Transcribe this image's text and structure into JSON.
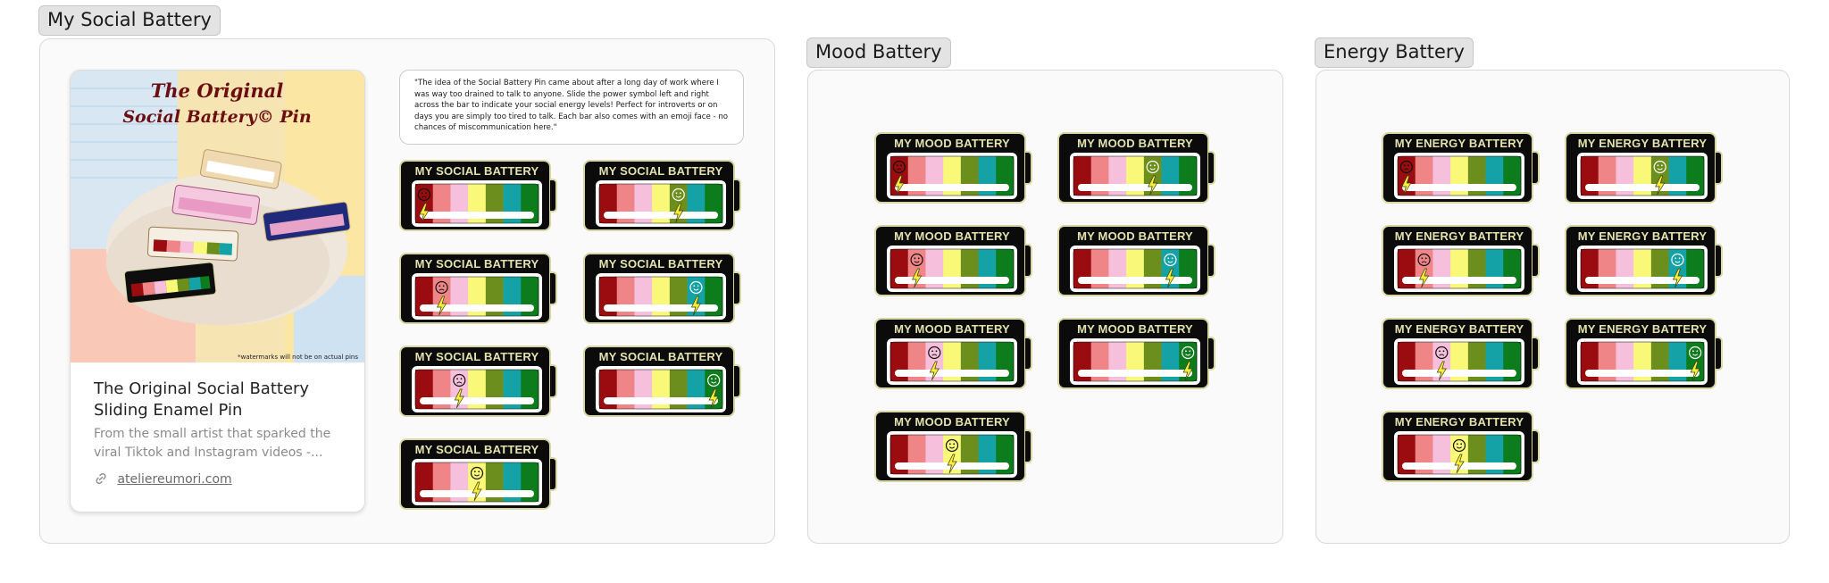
{
  "sections": {
    "social": {
      "label": "My Social Battery"
    },
    "mood": {
      "label": "Mood Battery"
    },
    "energy": {
      "label": "Energy Battery"
    }
  },
  "card": {
    "image_text_line1": "The Original",
    "image_text_line2": "Social Battery© Pin",
    "watermark_note": "*watermarks will not be on actual pins",
    "title": "The Original Social Battery Sliding Enamel Pin",
    "description": "From the small artist that sparked the viral Tiktok and Instagram videos -...",
    "link": "ateliereumori.com"
  },
  "quote": "\"The idea of the Social Battery Pin came about after a long day of work where I was way too drained to talk to anyone. Slide the power symbol left and right across the bar to indicate your social energy levels! Perfect for introverts or on days you are simply too tired to talk. Each bar also comes with an emoji face - no chances of miscommunication here.\"",
  "battery_titles": {
    "social": "MY SOCIAL BATTERY",
    "mood": "MY MOOD BATTERY",
    "energy": "MY ENERGY BATTERY"
  },
  "colors": {
    "segments": [
      "#9a0c0f",
      "#ef8587",
      "#f6c0dc",
      "#f9f879",
      "#6c8e1c",
      "#15a2a6",
      "#0d7c1c"
    ],
    "battery_border": "#d8d6a2",
    "title_text": "#e3e1ac"
  },
  "batteries": {
    "social": [
      {
        "level": 1,
        "face": "sad"
      },
      {
        "level": 5,
        "face": "happy"
      },
      {
        "level": 2,
        "face": "sad"
      },
      {
        "level": 6,
        "face": "happy"
      },
      {
        "level": 3,
        "face": "sad"
      },
      {
        "level": 7,
        "face": "happy"
      },
      {
        "level": 4,
        "face": "happy"
      }
    ],
    "mood": [
      {
        "level": 1,
        "face": "sad"
      },
      {
        "level": 5,
        "face": "happy"
      },
      {
        "level": 2,
        "face": "happy"
      },
      {
        "level": 6,
        "face": "happy"
      },
      {
        "level": 3,
        "face": "sad"
      },
      {
        "level": 7,
        "face": "happy"
      },
      {
        "level": 4,
        "face": "happy"
      }
    ],
    "energy": [
      {
        "level": 1,
        "face": "sad"
      },
      {
        "level": 5,
        "face": "happy"
      },
      {
        "level": 2,
        "face": "sad"
      },
      {
        "level": 6,
        "face": "happy"
      },
      {
        "level": 3,
        "face": "sad"
      },
      {
        "level": 7,
        "face": "happy"
      },
      {
        "level": 4,
        "face": "happy"
      }
    ]
  }
}
